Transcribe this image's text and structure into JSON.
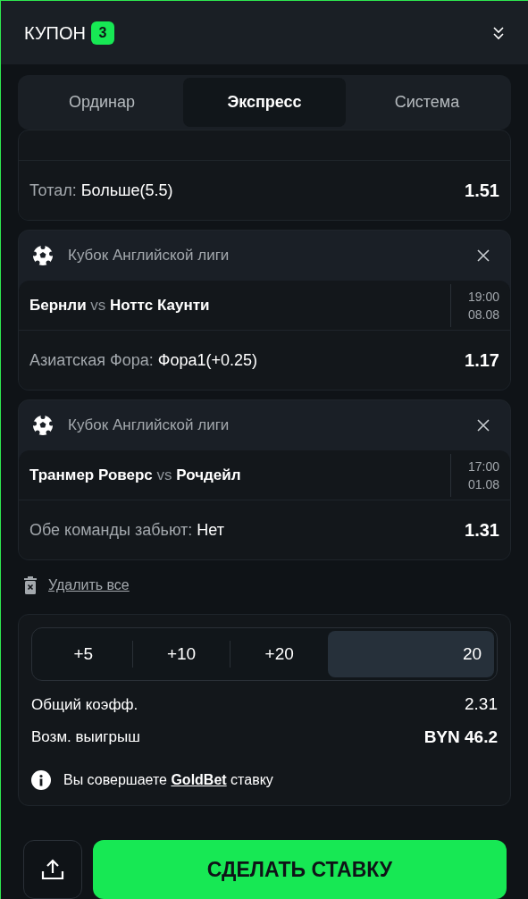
{
  "header": {
    "title": "КУПОН",
    "badge": "3"
  },
  "tabs": [
    {
      "label": "Ординар",
      "selected": false
    },
    {
      "label": "Экспресс",
      "selected": true
    },
    {
      "label": "Система",
      "selected": false
    }
  ],
  "bets": [
    {
      "kind": "partial",
      "market": "Тотал:",
      "pick": "Больше(5.5)",
      "odds": "1.51"
    },
    {
      "kind": "full",
      "league": "Кубок Английской лиги",
      "home": "Бернли",
      "vs": "vs",
      "away": "Ноттс Каунти",
      "time": "19:00",
      "date": "08.08",
      "market": "Азиатская Фора:",
      "pick": "Фора1(+0.25)",
      "odds": "1.17"
    },
    {
      "kind": "full",
      "league": "Кубок Английской лиги",
      "home": "Транмер Роверс",
      "vs": "vs",
      "away": "Рочдейл",
      "time": "17:00",
      "date": "01.08",
      "market": "Обе команды забьют:",
      "pick": "Нет",
      "odds": "1.31"
    }
  ],
  "delete_all": "Удалить все",
  "stake": {
    "quick": [
      "+5",
      "+10",
      "+20"
    ],
    "amount": "20"
  },
  "summary": [
    {
      "label": "Общий коэфф.",
      "value": "2.31",
      "bold": false
    },
    {
      "label": "Возм. выигрыш",
      "value": "BYN 46.2",
      "bold": true
    }
  ],
  "info": {
    "prefix": "Вы совершаете",
    "link": "GoldBet",
    "suffix": "ставку"
  },
  "submit": "СДЕЛАТЬ СТАВКУ"
}
